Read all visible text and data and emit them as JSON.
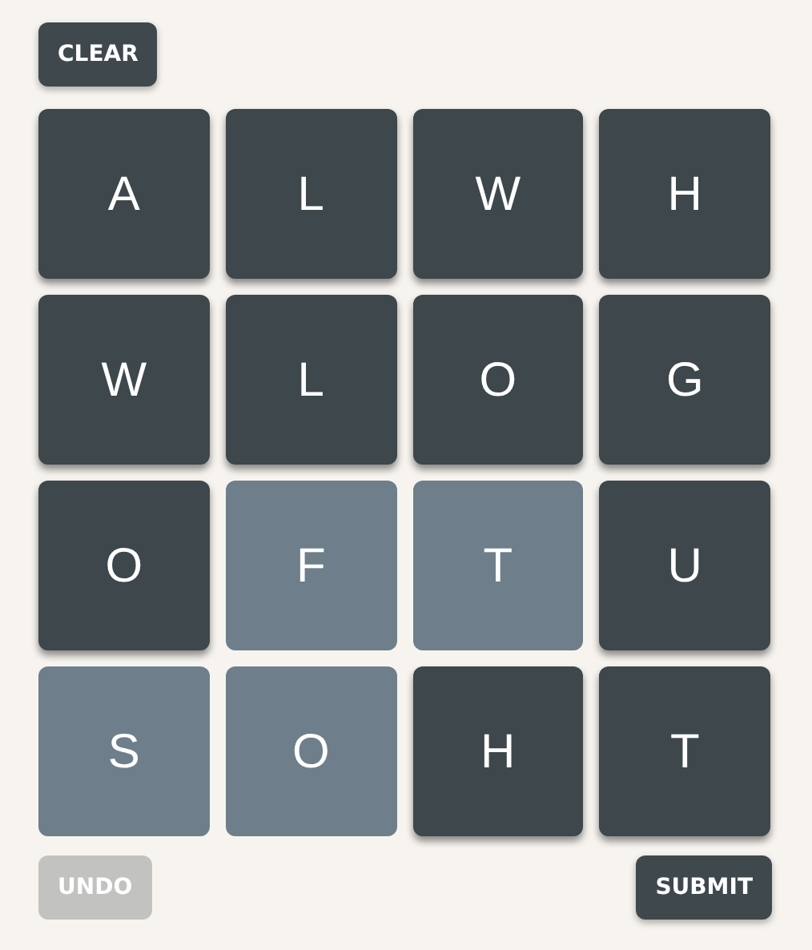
{
  "clear_button": {
    "label": "CLEAR"
  },
  "tiles": [
    {
      "letter": "A",
      "selected": false
    },
    {
      "letter": "L",
      "selected": false
    },
    {
      "letter": "W",
      "selected": false
    },
    {
      "letter": "H",
      "selected": false
    },
    {
      "letter": "W",
      "selected": false
    },
    {
      "letter": "L",
      "selected": false
    },
    {
      "letter": "O",
      "selected": false
    },
    {
      "letter": "G",
      "selected": false
    },
    {
      "letter": "O",
      "selected": false
    },
    {
      "letter": "F",
      "selected": true
    },
    {
      "letter": "T",
      "selected": true
    },
    {
      "letter": "U",
      "selected": false
    },
    {
      "letter": "S",
      "selected": true
    },
    {
      "letter": "O",
      "selected": true
    },
    {
      "letter": "H",
      "selected": false
    },
    {
      "letter": "T",
      "selected": false
    }
  ],
  "undo_button": {
    "label": "UNDO",
    "disabled": true
  },
  "submit_button": {
    "label": "SUBMIT",
    "disabled": false
  }
}
